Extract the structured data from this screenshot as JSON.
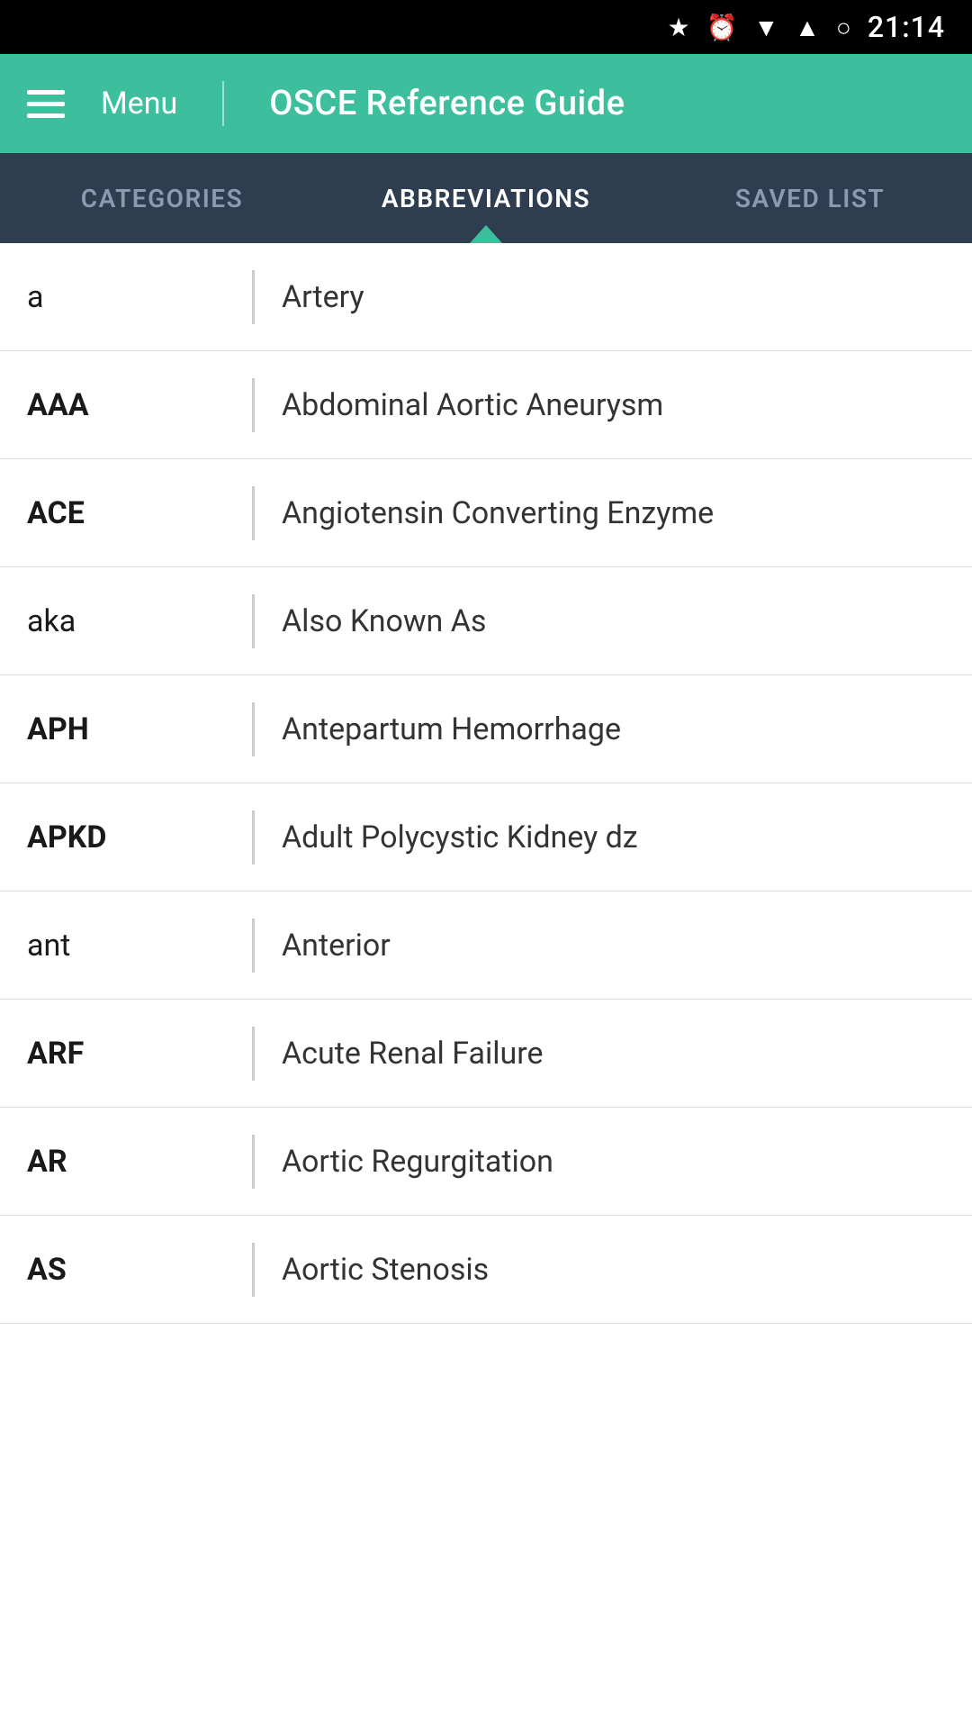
{
  "statusBar": {
    "time": "21:14",
    "icons": [
      "bluetooth",
      "alarm",
      "wifi",
      "signal",
      "battery"
    ]
  },
  "header": {
    "menuLabel": "Menu",
    "title": "OSCE Reference Guide"
  },
  "tabs": [
    {
      "id": "categories",
      "label": "CATEGORIES",
      "active": false
    },
    {
      "id": "abbreviations",
      "label": "ABBREVIATIONS",
      "active": true
    },
    {
      "id": "savedList",
      "label": "SAVED LIST",
      "active": false
    }
  ],
  "abbreviations": [
    {
      "key": "a",
      "keyLight": true,
      "value": "Artery"
    },
    {
      "key": "AAA",
      "keyLight": false,
      "value": "Abdominal Aortic Aneurysm"
    },
    {
      "key": "ACE",
      "keyLight": false,
      "value": "Angiotensin Converting Enzyme"
    },
    {
      "key": "aka",
      "keyLight": true,
      "value": "Also Known As"
    },
    {
      "key": "APH",
      "keyLight": false,
      "value": "Antepartum Hemorrhage"
    },
    {
      "key": "APKD",
      "keyLight": false,
      "value": "Adult Polycystic Kidney dz"
    },
    {
      "key": "ant",
      "keyLight": true,
      "value": "Anterior"
    },
    {
      "key": "ARF",
      "keyLight": false,
      "value": "Acute Renal Failure"
    },
    {
      "key": "AR",
      "keyLight": false,
      "value": "Aortic Regurgitation"
    },
    {
      "key": "AS",
      "keyLight": false,
      "value": "Aortic Stenosis"
    }
  ]
}
